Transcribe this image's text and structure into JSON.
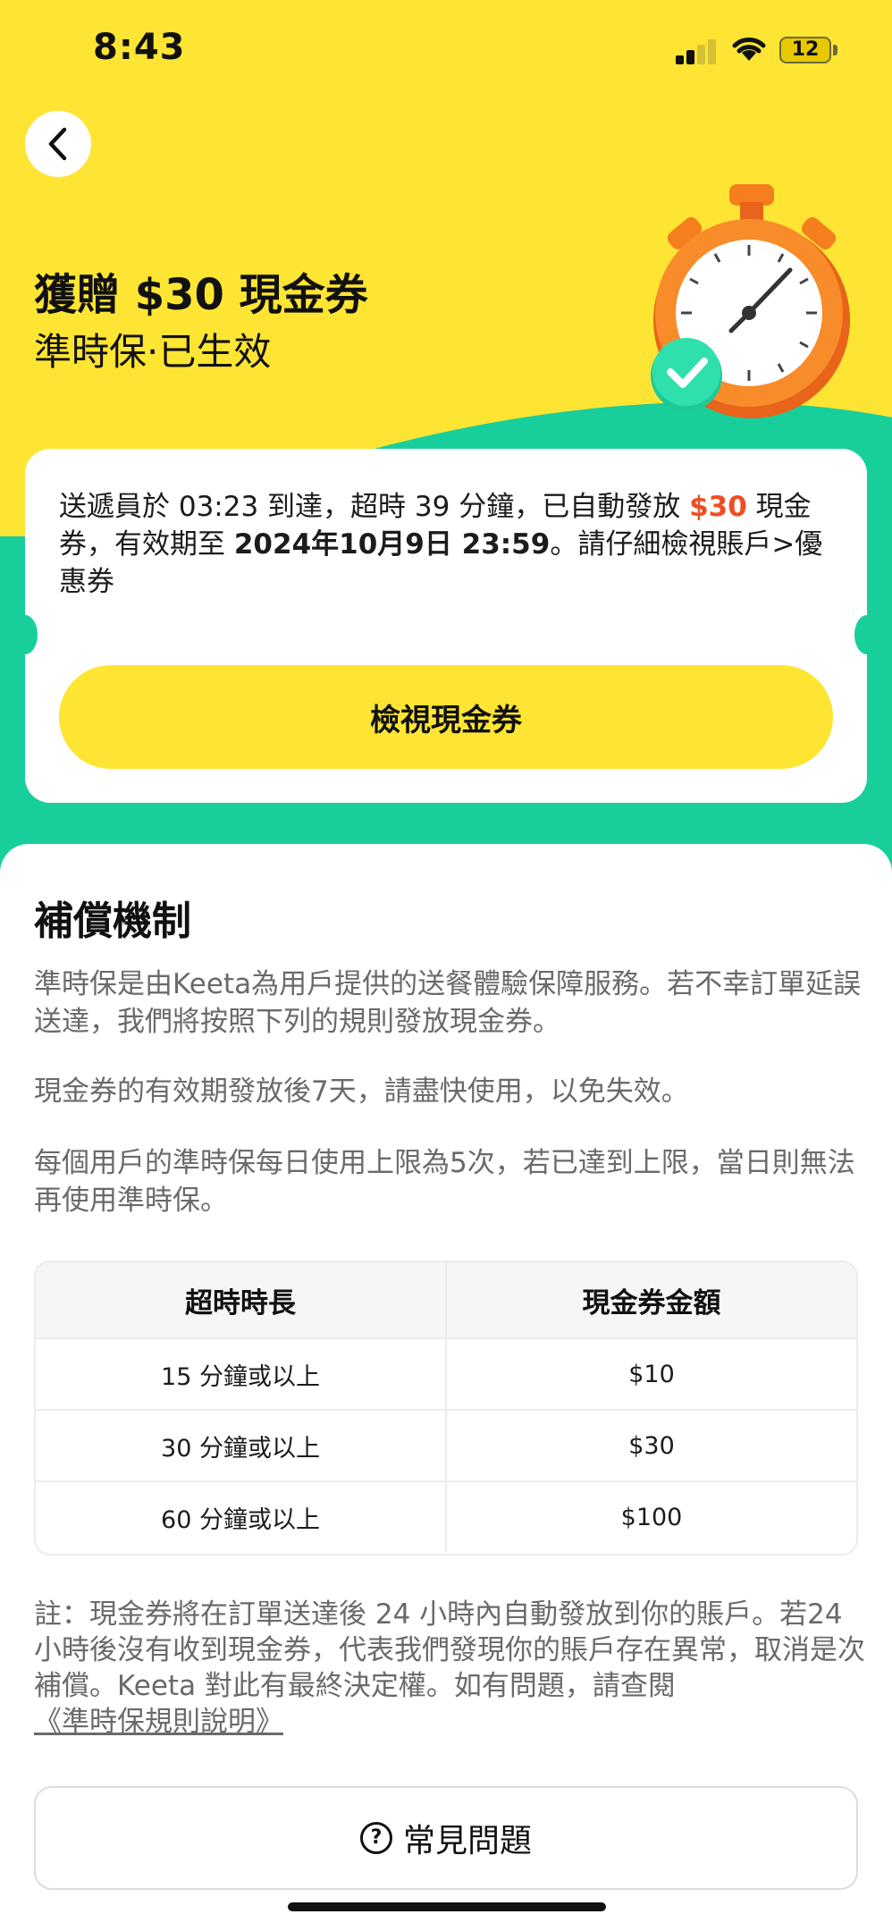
{
  "status_bar": {
    "time": "8:43",
    "battery": "12"
  },
  "hero": {
    "title": "獲贈 $30 現金券",
    "subtitle": "準時保·已生效"
  },
  "info_card": {
    "text_1": "送遞員於 03:23 到達，超時 39 分鐘，已自動發放 ",
    "amount": "$30",
    "text_2": " 現金券，有效期至 ",
    "expiry": "2024年10月9日 23:59",
    "text_3": "。請仔細檢視賬戶>優惠券",
    "button_label": "檢視現金券"
  },
  "sheet": {
    "title": "補償機制",
    "paragraphs": [
      "準時保是由Keeta為用戶提供的送餐體驗保障服務。若不幸訂單延誤送達，我們將按照下列的規則發放現金券。",
      "現金券的有效期發放後7天，請盡快使用，以免失效。",
      "每個用戶的準時保每日使用上限為5次，若已達到上限，當日則無法再使用準時保。"
    ],
    "table": {
      "headers": [
        "超時時長",
        "現金券金額"
      ],
      "rows": [
        [
          "15 分鐘或以上",
          "$10"
        ],
        [
          "30 分鐘或以上",
          "$30"
        ],
        [
          "60 分鐘或以上",
          "$100"
        ]
      ]
    },
    "note": "註：現金券將在訂單送達後 24 小時內自動發放到你的賬戶。若24 小時後沒有收到現金券，代表我們發現你的賬戶存在異常，取消是次補償。Keeta 對此有最終決定權。如有問題，請查閱",
    "note_link": "《準時保規則說明》",
    "faq_label": "常見問題"
  },
  "colors": {
    "yellow": "#FEE533",
    "green": "#18CF9B",
    "red": "#F04D23"
  }
}
